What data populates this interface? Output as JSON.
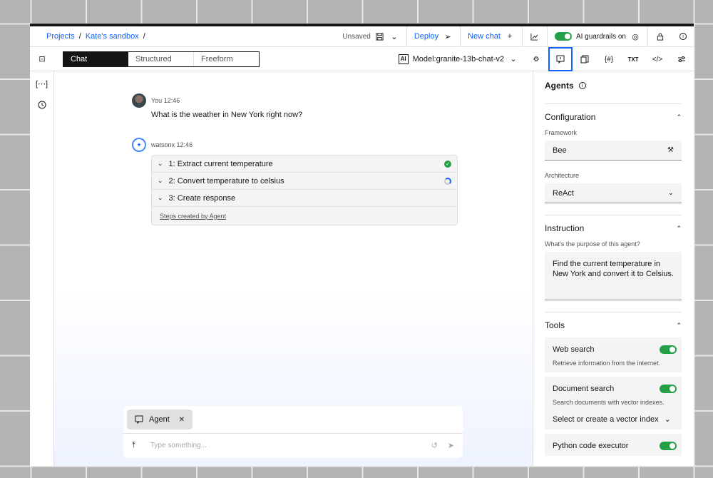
{
  "breadcrumb": {
    "projects": "Projects",
    "sandbox": "Kate's sandbox",
    "sep": "/"
  },
  "topbar": {
    "unsaved": "Unsaved",
    "deploy": "Deploy",
    "new_chat": "New chat",
    "guardrails": "AI guardrails on",
    "guardrails_enabled": true
  },
  "modes": {
    "chat": "Chat",
    "structured": "Structured",
    "freeform": "Freeform",
    "active": "chat"
  },
  "model": {
    "badge": "AI",
    "label": "Model:granite-13b-chat-v2"
  },
  "toolbar_icons": [
    "settings-icon",
    "agent-chat-icon",
    "documents-icon",
    "variables-icon",
    "text-icon",
    "code-icon",
    "sliders-icon"
  ],
  "conversation": {
    "user": {
      "name": "You",
      "time": "12:46",
      "text": "What is the weather in New York right now?"
    },
    "bot": {
      "name": "watsonx",
      "time": "12:46",
      "steps": [
        {
          "label": "1: Extract current temperature",
          "status": "done"
        },
        {
          "label": "2: Convert temperature to celsius",
          "status": "loading"
        },
        {
          "label": "3: Create response",
          "status": "pending"
        }
      ],
      "footer": "Steps created by Agent"
    }
  },
  "composer": {
    "chip": "Agent",
    "placeholder": "Type something..."
  },
  "panel": {
    "title": "Agents",
    "configuration": {
      "heading": "Configuration",
      "framework_label": "Framework",
      "framework_value": "Bee",
      "architecture_label": "Architecture",
      "architecture_value": "ReAct"
    },
    "instruction": {
      "heading": "Instruction",
      "hint": "What's the purpose of this agent?",
      "value": "Find the current temperature in New York and convert it to Celsius."
    },
    "tools": {
      "heading": "Tools",
      "items": [
        {
          "name": "Web search",
          "desc": "Retrieve information from the internet.",
          "enabled": true
        },
        {
          "name": "Document search",
          "desc": "Search documents with vector indexes.",
          "select": "Select or create a vector index",
          "enabled": true
        },
        {
          "name": "Python code executor",
          "enabled": true
        }
      ]
    }
  },
  "colors": {
    "accent": "#0f62fe",
    "success": "#24a148",
    "dark": "#161616"
  }
}
